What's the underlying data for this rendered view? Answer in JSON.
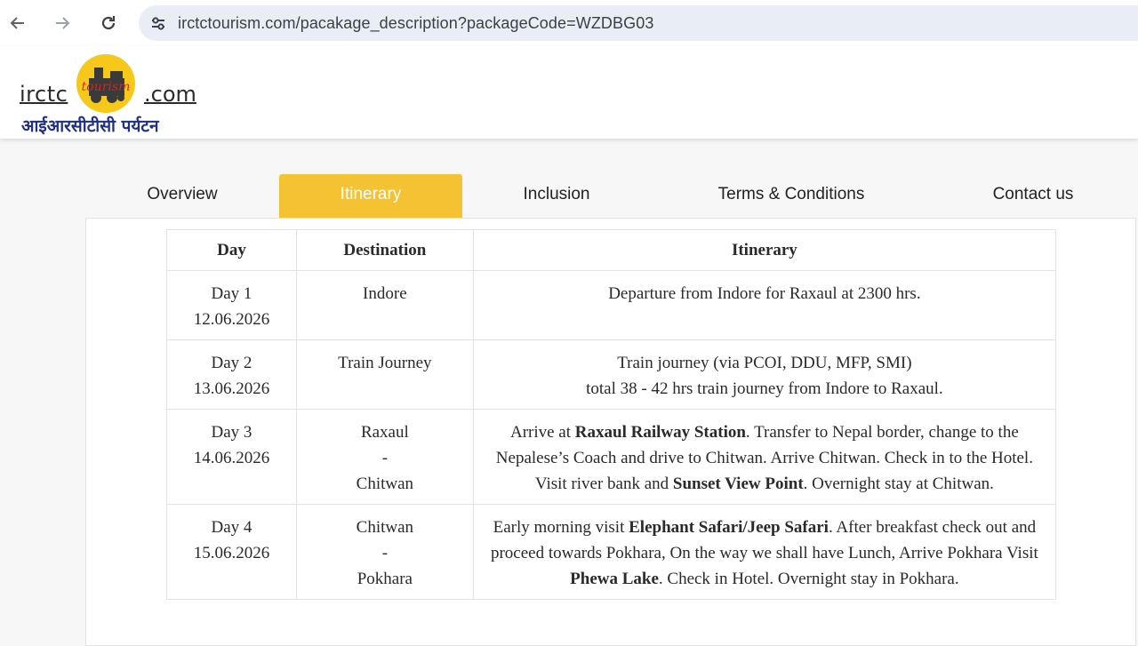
{
  "browser": {
    "url": "irctctourism.com/pacakage_description?packageCode=WZDBG03",
    "icons": [
      "back-arrow-icon",
      "forward-arrow-icon",
      "reload-icon",
      "site-info-icon"
    ]
  },
  "header": {
    "logo_prefix": "irctc",
    "logo_suffix": ".com",
    "logo_emblem_text": "tourism",
    "logo_hindi": "आईआरसीटीसी पर्यटन"
  },
  "tabs": [
    {
      "label": "Overview",
      "active": false
    },
    {
      "label": "Itinerary",
      "active": true
    },
    {
      "label": "Inclusion",
      "active": false
    },
    {
      "label": "Terms & Conditions",
      "active": false
    },
    {
      "label": "Contact us",
      "active": false
    }
  ],
  "colors": {
    "accent": "#f5c234",
    "logo_hindi": "#1f2f8a"
  },
  "table": {
    "headers": [
      "Day",
      "Destination",
      "Itinerary"
    ],
    "rows": [
      {
        "day": "Day 1",
        "date": "12.06.2026",
        "destination": [
          "Indore"
        ],
        "itinerary": [
          {
            "t": "Departure from Indore for Raxaul at 2300 hrs."
          }
        ]
      },
      {
        "day": "Day 2",
        "date": "13.06.2026",
        "destination": [
          "Train Journey"
        ],
        "itinerary": [
          {
            "t": "Train journey (via PCOI, DDU, MFP, SMI)"
          },
          {
            "t": "\ntotal 38 - 42 hrs train journey from Indore to Raxaul."
          }
        ]
      },
      {
        "day": "Day 3",
        "date": "14.06.2026",
        "destination": [
          "Raxaul",
          "-",
          "Chitwan"
        ],
        "itinerary": [
          {
            "t": "Arrive at "
          },
          {
            "t": "Raxaul Railway Station",
            "b": true
          },
          {
            "t": ". Transfer to Nepal border, change to the Nepalese’s Coach and drive to Chitwan. Arrive Chitwan. Check in to the Hotel. Visit river bank and "
          },
          {
            "t": "Sunset View Point",
            "b": true
          },
          {
            "t": ". Overnight stay at Chitwan."
          }
        ]
      },
      {
        "day": "Day 4",
        "date": "15.06.2026",
        "destination": [
          "Chitwan",
          "-",
          "Pokhara"
        ],
        "itinerary": [
          {
            "t": "Early morning visit "
          },
          {
            "t": "Elephant Safari/Jeep Safari",
            "b": true
          },
          {
            "t": ". After breakfast check out and proceed towards Pokhara, On the way we shall have Lunch, Arrive Pokhara Visit "
          },
          {
            "t": "Phewa Lake",
            "b": true
          },
          {
            "t": ". Check in Hotel. Overnight stay in Pokhara."
          }
        ]
      }
    ]
  }
}
